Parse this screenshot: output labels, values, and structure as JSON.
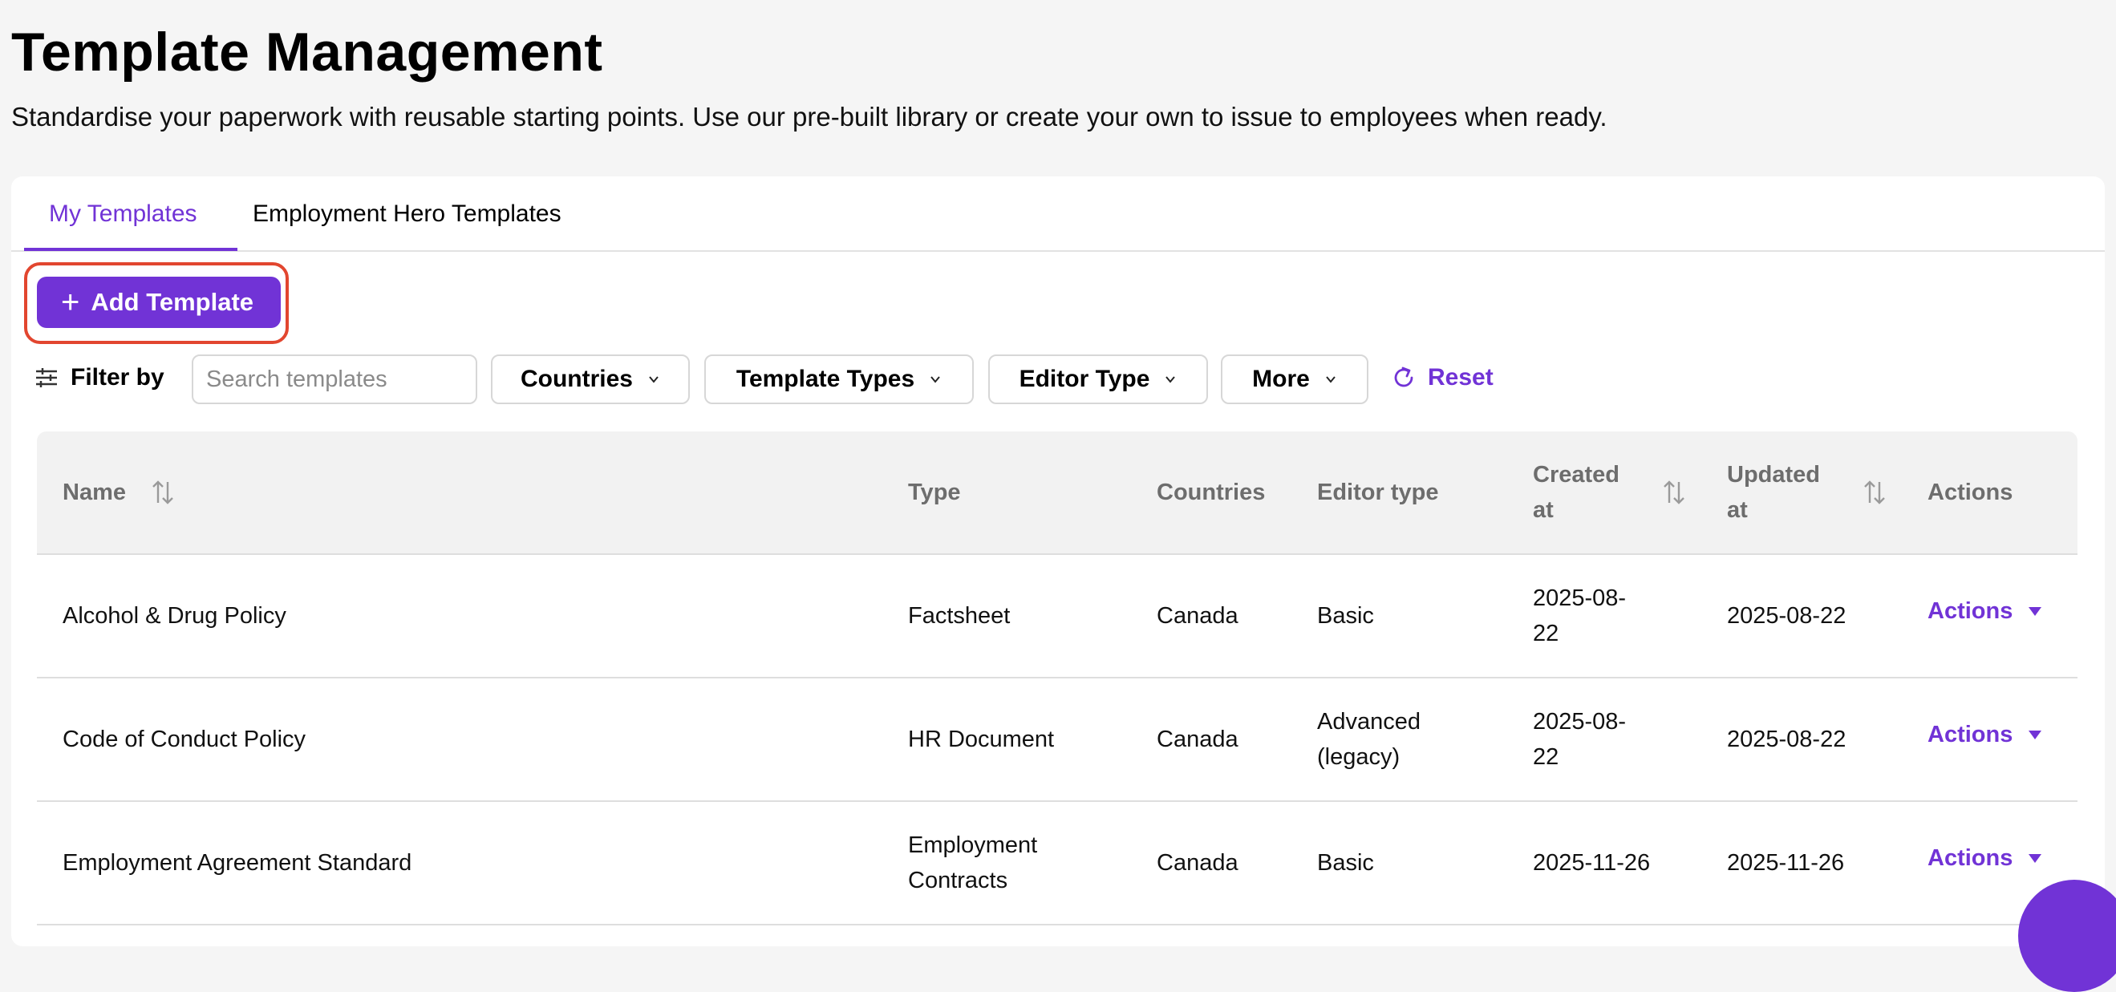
{
  "header": {
    "title": "Template Management",
    "subtitle": "Standardise your paperwork with reusable starting points. Use our pre-built library or create your own to issue to employees when ready."
  },
  "tabs": [
    {
      "label": "My Templates",
      "active": true
    },
    {
      "label": "Employment Hero Templates",
      "active": false
    }
  ],
  "toolbar": {
    "add_label": "Add Template"
  },
  "filters": {
    "label": "Filter by",
    "search_placeholder": "Search templates",
    "countries": "Countries",
    "template_types": "Template Types",
    "editor_type": "Editor Type",
    "more": "More",
    "reset": "Reset"
  },
  "table": {
    "columns": {
      "name": "Name",
      "type": "Type",
      "countries": "Countries",
      "editor_type": "Editor type",
      "created_at_1": "Created",
      "created_at_2": "at",
      "updated_at_1": "Updated",
      "updated_at_2": "at",
      "actions": "Actions"
    },
    "rows": [
      {
        "name": "Alcohol & Drug Policy",
        "type_1": "Factsheet",
        "type_2": "",
        "country": "Canada",
        "editor_1": "Basic",
        "editor_2": "",
        "created_1": "2025-08-",
        "created_2": "22",
        "updated": "2025-08-22",
        "action": "Actions"
      },
      {
        "name": "Code of Conduct Policy",
        "type_1": "HR Document",
        "type_2": "",
        "country": "Canada",
        "editor_1": "Advanced",
        "editor_2": "(legacy)",
        "created_1": "2025-08-",
        "created_2": "22",
        "updated": "2025-08-22",
        "action": "Actions"
      },
      {
        "name": "Employment Agreement Standard",
        "type_1": "Employment",
        "type_2": "Contracts",
        "country": "Canada",
        "editor_1": "Basic",
        "editor_2": "",
        "created_1": "2025-11-26",
        "created_2": "",
        "updated": "2025-11-26",
        "action": "Actions"
      }
    ]
  },
  "colors": {
    "accent": "#7133d6",
    "highlight": "#e2462f"
  }
}
